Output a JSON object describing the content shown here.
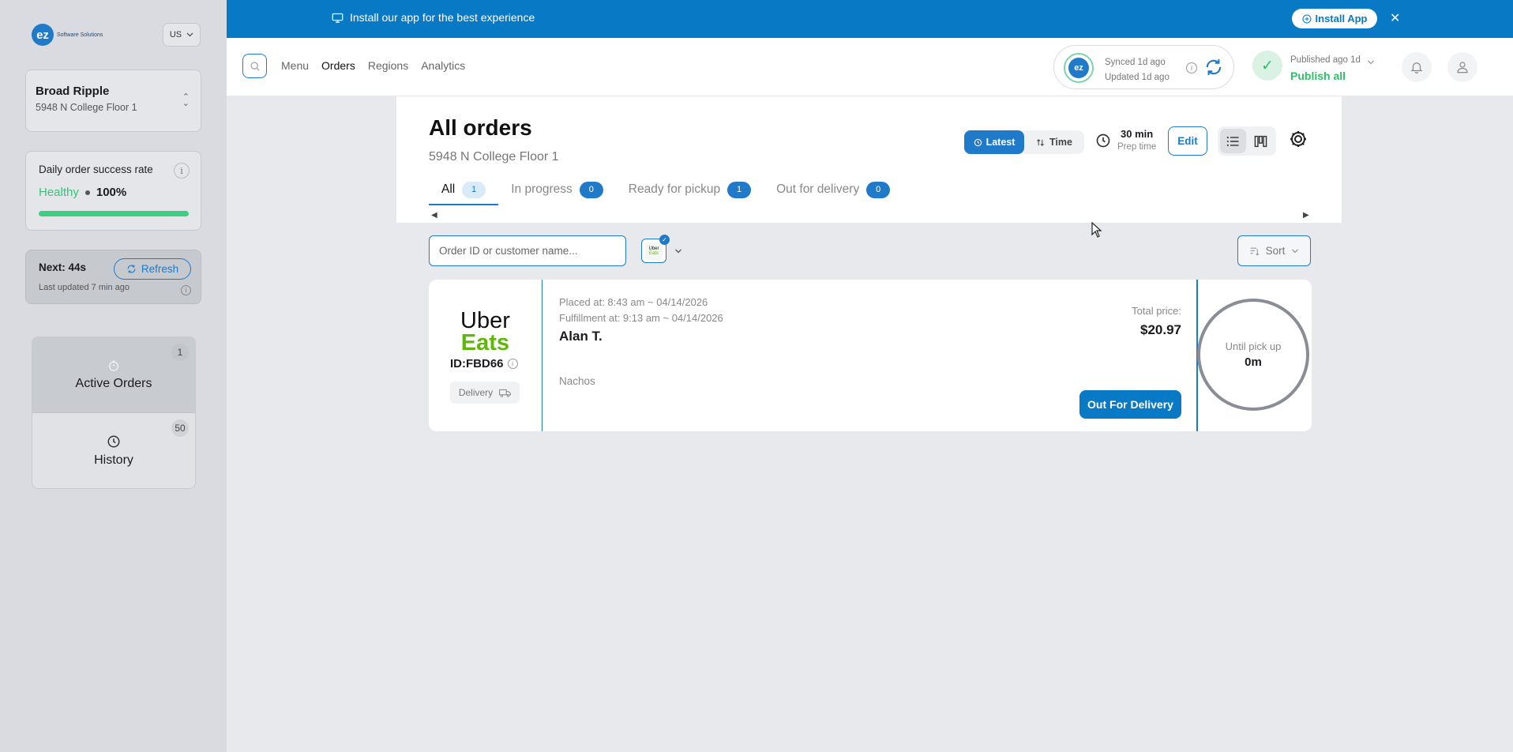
{
  "sidebar": {
    "logo_text": "ez",
    "logo_tagline": "Software Solutions",
    "country": "US",
    "store": {
      "name": "Broad Ripple",
      "address": "5948 N College Floor 1"
    },
    "success_rate": {
      "title": "Daily order success rate",
      "status": "Healthy",
      "percent": "100%",
      "progress_fraction": 1.0
    },
    "next": {
      "label": "Next: 44s",
      "refresh_label": "Refresh",
      "last_updated": "Last updated 7 min ago"
    },
    "nav": [
      {
        "label": "Active Orders",
        "count": "1",
        "icon": "timer-icon"
      },
      {
        "label": "History",
        "count": "50",
        "icon": "clock-icon"
      }
    ]
  },
  "banner": {
    "message": "Install our app for the best experience",
    "install_label": "Install App"
  },
  "header": {
    "nav": [
      "Menu",
      "Orders",
      "Regions",
      "Analytics"
    ],
    "sync": {
      "synced": "Synced 1d ago",
      "updated": "Updated 1d ago",
      "logo": "ez"
    },
    "publish": {
      "status": "Published ago 1d",
      "action": "Publish all"
    }
  },
  "main": {
    "title": "All orders",
    "subtitle": "5948 N College Floor 1",
    "sort_toggle": {
      "latest": "Latest",
      "time": "Time"
    },
    "prep": {
      "value": "30 min",
      "label": "Prep time"
    },
    "edit_label": "Edit",
    "tabs": [
      {
        "label": "All",
        "count": "1"
      },
      {
        "label": "In progress",
        "count": "0"
      },
      {
        "label": "Ready for pickup",
        "count": "1"
      },
      {
        "label": "Out for delivery",
        "count": "0"
      }
    ],
    "search_placeholder": "Order ID or customer name...",
    "sort_label": "Sort",
    "filter_chip": {
      "line1": "Uber",
      "line2": "Eats"
    }
  },
  "order": {
    "platform_line1": "Uber",
    "platform_line2": "Eats",
    "id": "ID:FBD66",
    "type": "Delivery",
    "placed": "Placed at: 8:43 am ~ 04/14/2026",
    "fulfillment": "Fulfillment at: 9:13 am ~ 04/14/2026",
    "customer": "Alan T.",
    "item": "Nachos",
    "price_label": "Total price:",
    "price": "$20.97",
    "action": "Out For Delivery",
    "timer_label": "Until pick up",
    "timer_value": "0m"
  },
  "colors": {
    "brand_blue": "#0779c5",
    "healthy_green": "#37c27a",
    "uber_eats_green": "#5fb709"
  }
}
